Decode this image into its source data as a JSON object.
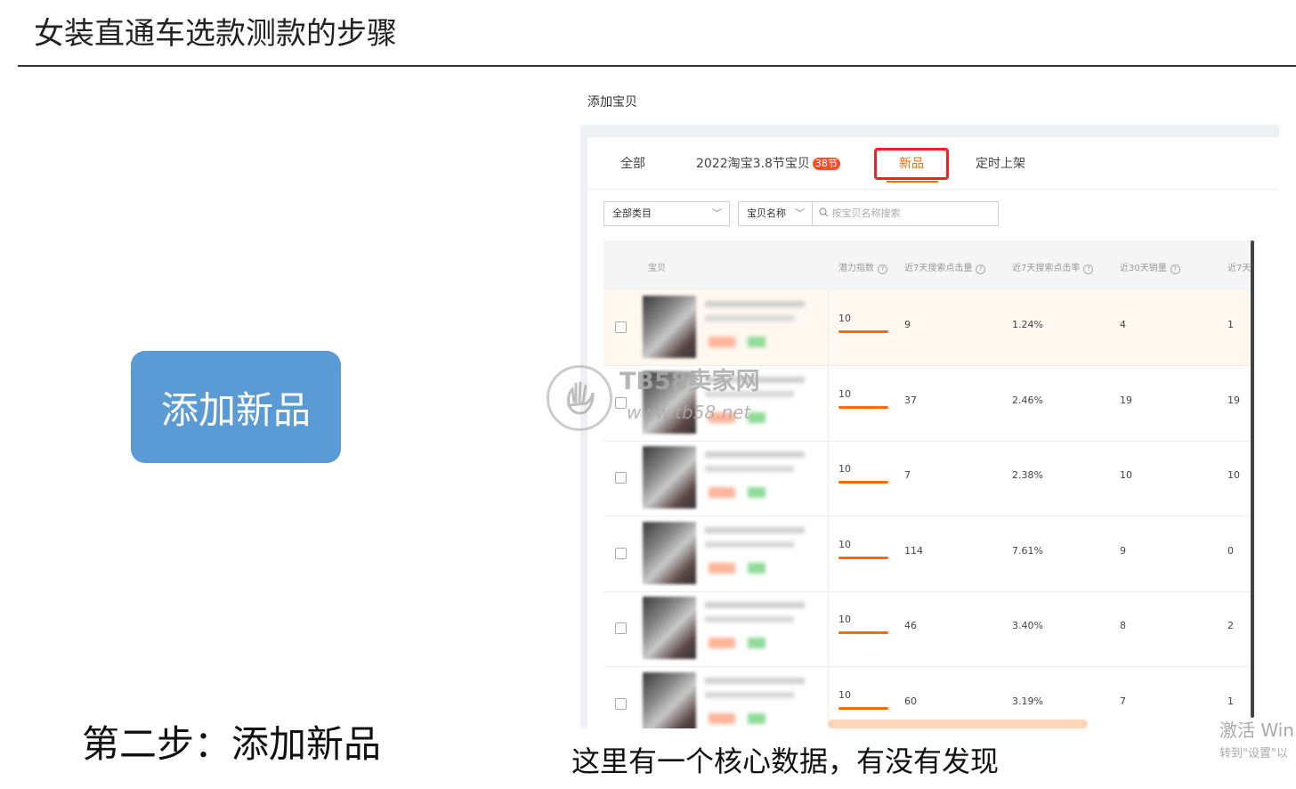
{
  "slide": {
    "title": "女装直通车选款测款的步骤",
    "step_button": "添加新品",
    "step_caption": "第二步：添加新品",
    "bottom_caption": "这里有一个核心数据，有没有发现"
  },
  "watermark": {
    "site": "TB58卖家网",
    "url": "www.tb58.net",
    "windows_line1": "激活 Win",
    "windows_line2": "转到\"设置\"以"
  },
  "panel": {
    "title": "添加宝贝",
    "tabs": [
      {
        "label": "全部"
      },
      {
        "label": "2022淘宝3.8节宝贝",
        "badge": "38节"
      },
      {
        "label": "新品",
        "active": true
      },
      {
        "label": "定时上架"
      }
    ],
    "filters": {
      "category": "全部类目",
      "field": "宝贝名称",
      "search_placeholder": "按宝贝名称搜索"
    },
    "table": {
      "headers": [
        "宝贝",
        "潜力指数",
        "近7天搜索点击量",
        "近7天搜索点击率",
        "近30天销量",
        "近7天"
      ],
      "rows": [
        {
          "potential": "10",
          "clicks7": "9",
          "ctr7": "1.24%",
          "sales30": "4",
          "col5": "1"
        },
        {
          "potential": "10",
          "clicks7": "37",
          "ctr7": "2.46%",
          "sales30": "19",
          "col5": "19"
        },
        {
          "potential": "10",
          "clicks7": "7",
          "ctr7": "2.38%",
          "sales30": "10",
          "col5": "10"
        },
        {
          "potential": "10",
          "clicks7": "114",
          "ctr7": "7.61%",
          "sales30": "9",
          "col5": "0"
        },
        {
          "potential": "10",
          "clicks7": "46",
          "ctr7": "3.40%",
          "sales30": "8",
          "col5": "2"
        },
        {
          "potential": "10",
          "clicks7": "60",
          "ctr7": "3.19%",
          "sales30": "7",
          "col5": "1"
        }
      ]
    }
  },
  "colors": {
    "accent": "#ff6a00",
    "button_blue": "#5b9bd5",
    "highlight_border": "#e22222"
  },
  "icons": {
    "search": "search-icon",
    "chevron": "chevron-down-icon",
    "help": "help-circle-icon"
  }
}
